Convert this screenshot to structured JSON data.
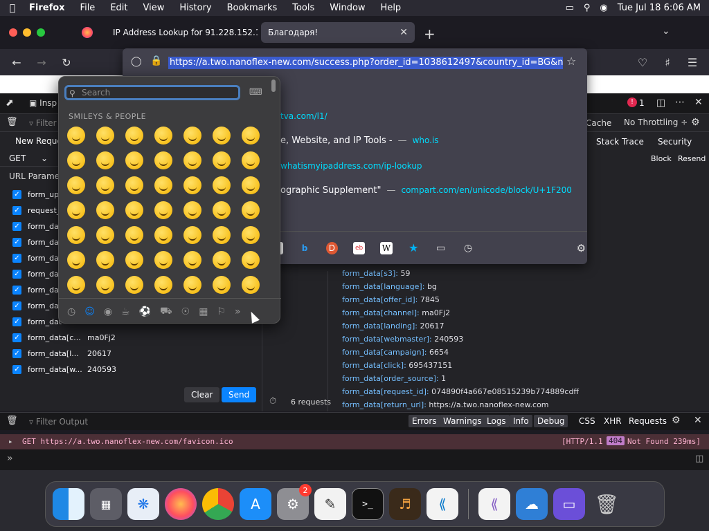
{
  "menubar": {
    "app": "Firefox",
    "items": [
      "File",
      "Edit",
      "View",
      "History",
      "Bookmarks",
      "Tools",
      "Window",
      "Help"
    ],
    "clock": "Tue Jul 18  6:06 AM"
  },
  "tabs": [
    {
      "title": "IP Address Lookup for 91.228.152.1..."
    },
    {
      "title": "Благодаря!"
    }
  ],
  "urlbar": {
    "url": "https://a.two.nanoflex-new.com/success.php?order_id=1038612497&country_id=BG&nam"
  },
  "suggestions": [
    {
      "title": "",
      "sub": "tva.com/l1/"
    },
    {
      "title": "e, Website, and IP Tools -",
      "sub": "who.is"
    },
    {
      "title": "",
      "sub": "whatismyipaddress.com/ip-lookup"
    },
    {
      "title": "ographic Supplement\"",
      "sub": "compart.com/en/unicode/block/U+1F200"
    }
  ],
  "devtools": {
    "inspector": "Insp",
    "filter": "Filter",
    "cache": "Cache",
    "throttling": "No Throttling ÷",
    "error_count": "1",
    "left_tab": "New Reque",
    "method": "GET",
    "url_params": "URL Paramet",
    "right_tabs": [
      "Stack Trace",
      "Security"
    ],
    "block": "Block",
    "resend": "Resend",
    "clear": "Clear",
    "send": "Send",
    "requests": "6 requests"
  },
  "params": [
    {
      "k": "form_up",
      "v": ""
    },
    {
      "k": "request_",
      "v": ""
    },
    {
      "k": "form_da",
      "v": ""
    },
    {
      "k": "form_da",
      "v": ""
    },
    {
      "k": "form_da",
      "v": ""
    },
    {
      "k": "form_da",
      "v": ""
    },
    {
      "k": "form_da",
      "v": ""
    },
    {
      "k": "form_da",
      "v": ""
    },
    {
      "k": "form_dat",
      "v": ""
    },
    {
      "k": "form_data[c...",
      "v": "ma0Fj2"
    },
    {
      "k": "form_data[l...",
      "v": "20617"
    },
    {
      "k": "form_data[w...",
      "v": "240593"
    }
  ],
  "form_data": [
    {
      "k": "form_data[s3]:",
      "v": "59"
    },
    {
      "k": "form_data[language]:",
      "v": "bg"
    },
    {
      "k": "form_data[offer_id]:",
      "v": "7845"
    },
    {
      "k": "form_data[channel]:",
      "v": "ma0Fj2"
    },
    {
      "k": "form_data[landing]:",
      "v": "20617"
    },
    {
      "k": "form_data[webmaster]:",
      "v": "240593"
    },
    {
      "k": "form_data[campaign]:",
      "v": "6654"
    },
    {
      "k": "form_data[click]:",
      "v": "695437151"
    },
    {
      "k": "form_data[order_source]:",
      "v": "1"
    },
    {
      "k": "form_data[request_id]:",
      "v": "074890f4a667e08515239b774889cdff"
    },
    {
      "k": "form_data[return_url]:",
      "v": "https://a.two.nanoflex-new.com"
    }
  ],
  "console": {
    "filter_placeholder": "Filter Output",
    "filters": [
      "Errors",
      "Warnings",
      "Logs",
      "Info",
      "Debug",
      "CSS",
      "XHR",
      "Requests"
    ],
    "error_line": "GET https://a.two.nanoflex-new.com/favicon.ico",
    "http": "[HTTP/1.1",
    "code": "404",
    "status": "Not Found 239ms]"
  },
  "emoji_picker": {
    "placeholder": "Search",
    "category": "SMILEYS & PEOPLE"
  },
  "dock": {
    "badge": "2"
  }
}
